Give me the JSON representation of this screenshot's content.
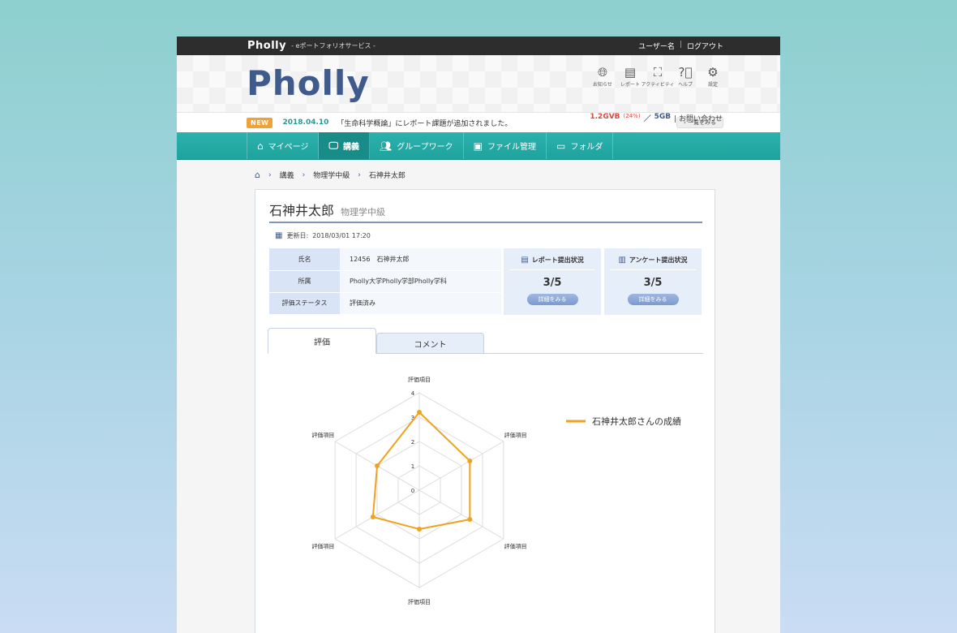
{
  "topbar": {
    "brand": "Pholly",
    "tagline": "- eポートフォリオサービス -",
    "user": "ユーザー名",
    "logout": "ログアウト",
    "sep": "|"
  },
  "header": {
    "logo": "Pholly",
    "icons": [
      {
        "label": "お知らせ",
        "icon": "globe-icon"
      },
      {
        "label": "レポート",
        "icon": "document-icon"
      },
      {
        "label": "アクティビティ",
        "icon": "network-icon"
      },
      {
        "label": "ヘルプ",
        "icon": "help-icon"
      },
      {
        "label": "設定",
        "icon": "gear-icon"
      }
    ],
    "usage": {
      "used": "1.2GVB",
      "percent": "(24%)",
      "slash": "／",
      "total": "5GB",
      "contact": "| お問い合わせ"
    }
  },
  "news": {
    "badge": "NEW",
    "date": "2018.04.10",
    "message": "「生命科学概論」にレポート課題が追加されました。",
    "more": "一覧をみる"
  },
  "nav": [
    {
      "label": "マイページ",
      "icon": "home-icon",
      "active": false
    },
    {
      "label": "講義",
      "icon": "lecture-icon",
      "active": true
    },
    {
      "label": "グループワーク",
      "icon": "group-icon",
      "active": false
    },
    {
      "label": "ファイル管理",
      "icon": "file-icon",
      "active": false
    },
    {
      "label": "フォルダ",
      "icon": "folder-icon",
      "active": false
    }
  ],
  "breadcrumb": {
    "items": [
      "講義",
      "物理学中級",
      "石神井太郎"
    ]
  },
  "student": {
    "name": "石神井太郎",
    "class": "物理学中級",
    "updated_label": "更新日:",
    "updated": "2018/03/01 17:20",
    "rows": [
      {
        "key": "氏名",
        "value": "12456　石神井太郎"
      },
      {
        "key": "所属",
        "value": "Pholly大学Pholly学部Pholly学科"
      },
      {
        "key": "評価ステータス",
        "value": "評価済み"
      }
    ]
  },
  "stats": [
    {
      "title": "レポート提出状況",
      "value": "3/5",
      "button": "詳細をみる",
      "icon": "report-icon"
    },
    {
      "title": "アンケート提出状況",
      "value": "3/5",
      "button": "詳細をみる",
      "icon": "clipboard-icon"
    }
  ],
  "tabs": {
    "evaluation": "評価",
    "comment": "コメント"
  },
  "chart_data": {
    "type": "radar",
    "categories": [
      "評価項目",
      "評価項目",
      "評価項目",
      "評価項目",
      "評価項目",
      "評価項目"
    ],
    "ticks": [
      "0",
      "1",
      "2",
      "3",
      "4"
    ],
    "rlim": [
      0,
      4
    ],
    "series": [
      {
        "name": "石神井太郎さんの成績",
        "values": [
          3.2,
          2.4,
          2.4,
          1.6,
          2.2,
          2.0
        ],
        "color": "#f0a21f"
      }
    ],
    "legend": "right"
  }
}
